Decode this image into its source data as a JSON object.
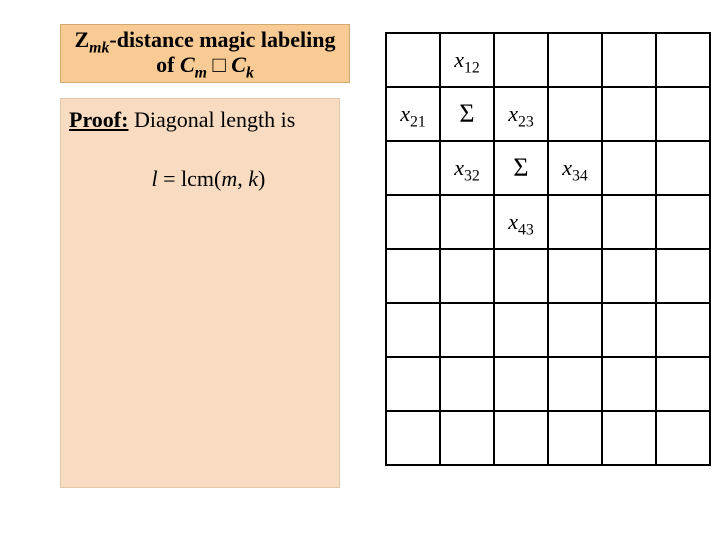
{
  "title": {
    "line1_pre": "Z",
    "line1_sub": "mk",
    "line1_post": "-distance magic labeling",
    "line2_pre": "of ",
    "line2_var1": "C",
    "line2_sub1": "m",
    "line2_op": " □ ",
    "line2_var2": "C",
    "line2_sub2": "k"
  },
  "proof": {
    "label": "Proof:",
    "text1": " Diagonal length is",
    "indent": "           ",
    "text2_var": "l",
    "text2_mid": " = lcm(",
    "text2_m": "m",
    "text2_comma": ", ",
    "text2_k": "k",
    "text2_close": ")"
  },
  "grid": {
    "sigma": "Σ",
    "x12_x": "x",
    "x12_s": "12",
    "x21_x": "x",
    "x21_s": "21",
    "x23_x": "x",
    "x23_s": "23",
    "x32_x": "x",
    "x32_s": "32",
    "x34_x": "x",
    "x34_s": "34",
    "x43_x": "x",
    "x43_s": "43"
  }
}
